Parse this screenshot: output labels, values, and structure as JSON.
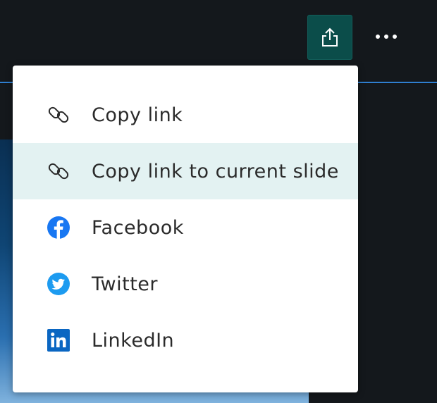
{
  "header": {
    "share_icon": "share-icon",
    "more_icon": "more-horizontal-icon",
    "accent_color": "#0b4d4a",
    "divider_color": "#2f7fd0"
  },
  "share_menu": {
    "items": [
      {
        "label": "Copy link",
        "icon": "link-icon",
        "active": false
      },
      {
        "label": "Copy link to current slide",
        "icon": "link-icon",
        "active": true
      },
      {
        "label": "Facebook",
        "icon": "facebook-icon",
        "active": false
      },
      {
        "label": "Twitter",
        "icon": "twitter-icon",
        "active": false
      },
      {
        "label": "LinkedIn",
        "icon": "linkedin-icon",
        "active": false
      }
    ],
    "active_background": "#e3f2f2"
  }
}
